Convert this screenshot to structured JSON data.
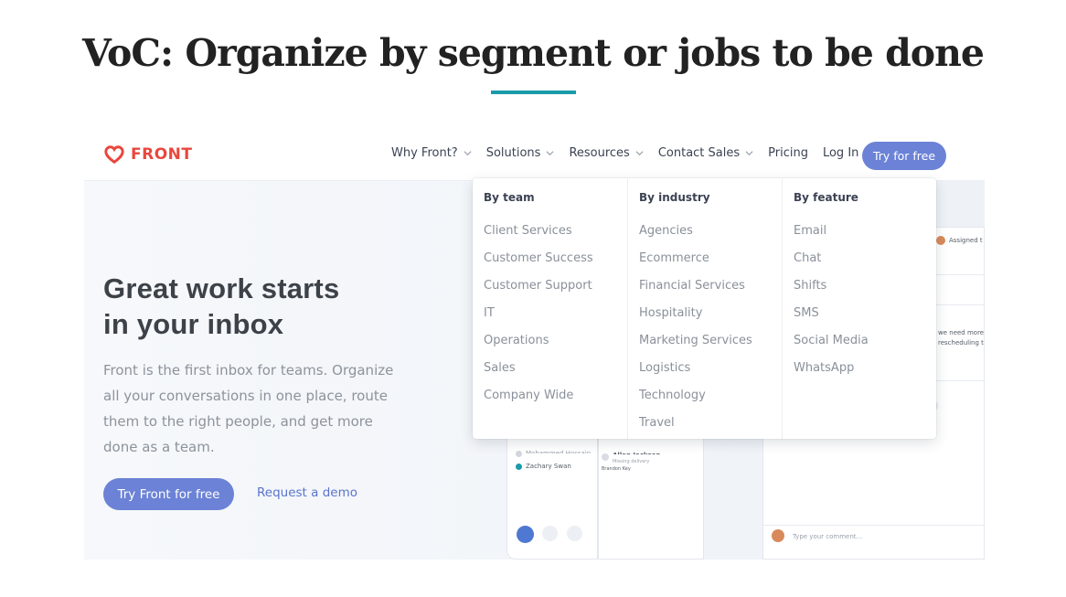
{
  "slide": {
    "title": "VoC: Organize by segment or jobs to be done",
    "accent_color": "#1b9aaa"
  },
  "nav": {
    "logo_text": "FRONT",
    "logo_icon": "heart-icon",
    "brand_color": "#e8473d",
    "items": [
      {
        "label": "Why Front?",
        "has_dropdown": true
      },
      {
        "label": "Solutions",
        "has_dropdown": true
      },
      {
        "label": "Resources",
        "has_dropdown": true
      },
      {
        "label": "Contact Sales",
        "has_dropdown": true
      },
      {
        "label": "Pricing",
        "has_dropdown": false
      },
      {
        "label": "Log In",
        "has_dropdown": false
      }
    ],
    "cta_label": "Try for free",
    "cta_color": "#6b82d6"
  },
  "hero": {
    "heading_line1": "Great work starts",
    "heading_line2": "in your inbox",
    "body": "Front is the first inbox for teams. Organize all your conversations in one place, route them to the right people, and get more done as a team.",
    "primary_cta": "Try Front for free",
    "secondary_cta": "Request a demo"
  },
  "dropdown": {
    "columns": [
      {
        "heading": "By team",
        "items": [
          "Client Services",
          "Customer Success",
          "Customer Support",
          "IT",
          "Operations",
          "Sales",
          "Company Wide"
        ]
      },
      {
        "heading": "By industry",
        "items": [
          "Agencies",
          "Ecommerce",
          "Financial Services",
          "Hospitality",
          "Marketing Services",
          "Logistics",
          "Technology",
          "Travel"
        ]
      },
      {
        "heading": "By feature",
        "items": [
          "Email",
          "Chat",
          "Shifts",
          "SMS",
          "Social Media",
          "WhatsApp"
        ]
      }
    ]
  },
  "app_preview": {
    "assigned_text": "Assigned t",
    "message_line1": "we need more",
    "message_line2": "rescheduling t",
    "contact_1": "Mohammed Hossain",
    "contact_2": "Zachary Swan",
    "card_title": "Allan Jackson",
    "card_sub": "Missing delivery",
    "card_tag": "Brandon Key",
    "comment_placeholder": "Type your comment..."
  }
}
